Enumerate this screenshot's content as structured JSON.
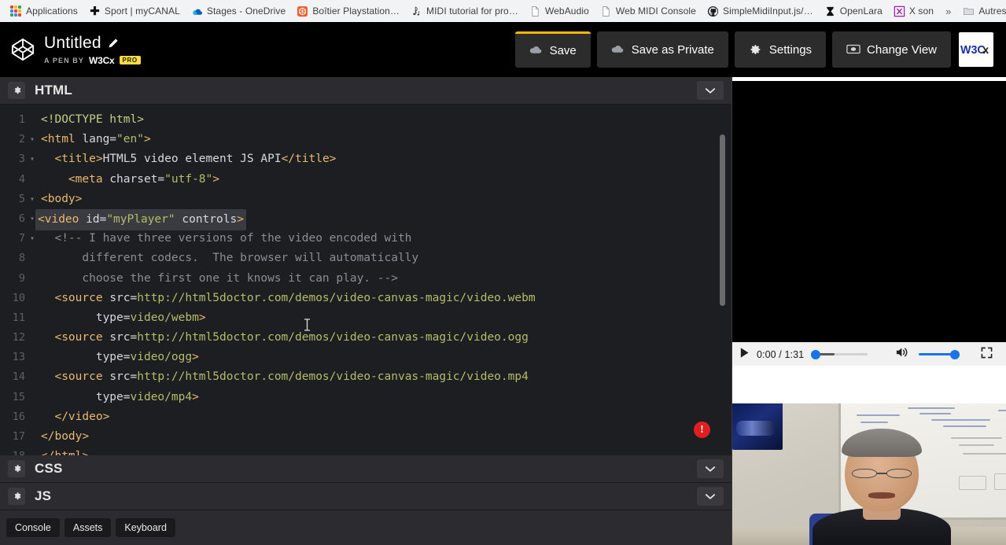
{
  "browser": {
    "bookmarks": [
      {
        "label": "Applications",
        "icon": "apps-grid-icon"
      },
      {
        "label": "Sport | myCANAL",
        "icon": "plus-cross-icon"
      },
      {
        "label": "Stages - OneDrive",
        "icon": "onedrive-cloud-icon"
      },
      {
        "label": "Boîtier Playstation…",
        "icon": "playstation-box-icon"
      },
      {
        "label": "MIDI tutorial for pro…",
        "icon": "music-note-icon"
      },
      {
        "label": "WebAudio",
        "icon": "page-icon"
      },
      {
        "label": "Web MIDI Console",
        "icon": "page-icon"
      },
      {
        "label": "SimpleMidiInput.js/…",
        "icon": "github-icon"
      },
      {
        "label": "OpenLara",
        "icon": "hourglass-icon"
      },
      {
        "label": "X son",
        "icon": "x-purple-icon"
      }
    ],
    "overflow_label": "»",
    "other_bookmarks": {
      "label": "Autres favoris",
      "icon": "folder-icon"
    }
  },
  "header": {
    "logo": "codepen-logo-icon",
    "pen_title": "Untitled",
    "edit_icon": "pencil-icon",
    "byline_prefix": "A PEN BY",
    "byline_user": "W3Cx",
    "pro_badge": "PRO",
    "buttons": [
      {
        "label": "Save",
        "icon": "cloud-icon",
        "accent": "#ffb800"
      },
      {
        "label": "Save as Private",
        "icon": "cloud-icon"
      },
      {
        "label": "Settings",
        "icon": "gear-icon"
      },
      {
        "label": "Change View",
        "icon": "view-rect-icon"
      }
    ],
    "brand_logo": "W3Cx"
  },
  "editor": {
    "panels": [
      {
        "name": "HTML",
        "gear": "gear-icon",
        "collapse": "chevron-down-icon"
      },
      {
        "name": "CSS",
        "gear": "gear-icon",
        "collapse": "chevron-down-icon"
      },
      {
        "name": "JS",
        "gear": "gear-icon",
        "collapse": "chevron-down-icon"
      }
    ],
    "error_badge": "!",
    "lines": [
      {
        "n": "1",
        "fold": "",
        "tokens": [
          {
            "t": "doctype",
            "s": "<!DOCTYPE html>"
          }
        ]
      },
      {
        "n": "2",
        "fold": "▾",
        "tokens": [
          {
            "t": "tag",
            "s": "<html "
          },
          {
            "t": "attr",
            "s": "lang="
          },
          {
            "t": "str",
            "s": "\"en\""
          },
          {
            "t": "tag",
            "s": ">"
          }
        ]
      },
      {
        "n": "3",
        "fold": "▾",
        "tokens": [
          {
            "t": "plain",
            "s": "  "
          },
          {
            "t": "tag",
            "s": "<title>"
          },
          {
            "t": "plain",
            "s": "HTML5 video element JS API"
          },
          {
            "t": "tag",
            "s": "</title>"
          }
        ]
      },
      {
        "n": "4",
        "fold": "",
        "tokens": [
          {
            "t": "plain",
            "s": "    "
          },
          {
            "t": "tag",
            "s": "<meta "
          },
          {
            "t": "attr",
            "s": "charset="
          },
          {
            "t": "str",
            "s": "\"utf-8\""
          },
          {
            "t": "tag",
            "s": ">"
          }
        ]
      },
      {
        "n": "5",
        "fold": "▾",
        "tokens": [
          {
            "t": "tag",
            "s": "<body>"
          }
        ]
      },
      {
        "n": "6",
        "fold": "▾",
        "sel": true,
        "tokens": [
          {
            "t": "tag",
            "s": "<video "
          },
          {
            "t": "attr",
            "s": "id="
          },
          {
            "t": "str",
            "s": "\"myPlayer\""
          },
          {
            "t": "attr",
            "s": " controls"
          },
          {
            "t": "tag",
            "s": ">"
          }
        ]
      },
      {
        "n": "7",
        "fold": "▾",
        "tokens": [
          {
            "t": "cmt",
            "s": "  <!-- I have three versions of the video encoded with"
          }
        ]
      },
      {
        "n": "8",
        "fold": "",
        "tokens": [
          {
            "t": "cmt",
            "s": "      different codecs.  The browser will automatically"
          }
        ]
      },
      {
        "n": "9",
        "fold": "",
        "tokens": [
          {
            "t": "cmt",
            "s": "      choose the first one it knows it can play. -->"
          }
        ]
      },
      {
        "n": "10",
        "fold": "",
        "tokens": [
          {
            "t": "plain",
            "s": "  "
          },
          {
            "t": "tag",
            "s": "<source "
          },
          {
            "t": "attr",
            "s": "src="
          },
          {
            "t": "val",
            "s": "http://html5doctor.com/demos/video-canvas-magic/video.webm"
          }
        ]
      },
      {
        "n": "11",
        "fold": "",
        "tokens": [
          {
            "t": "plain",
            "s": "        "
          },
          {
            "t": "attr",
            "s": "type="
          },
          {
            "t": "val",
            "s": "video/webm"
          },
          {
            "t": "tag",
            "s": ">"
          }
        ]
      },
      {
        "n": "12",
        "fold": "",
        "tokens": [
          {
            "t": "plain",
            "s": "  "
          },
          {
            "t": "tag",
            "s": "<source "
          },
          {
            "t": "attr",
            "s": "src="
          },
          {
            "t": "val",
            "s": "http://html5doctor.com/demos/video-canvas-magic/video.ogg"
          }
        ]
      },
      {
        "n": "13",
        "fold": "",
        "tokens": [
          {
            "t": "plain",
            "s": "        "
          },
          {
            "t": "attr",
            "s": "type="
          },
          {
            "t": "val",
            "s": "video/ogg"
          },
          {
            "t": "tag",
            "s": ">"
          }
        ]
      },
      {
        "n": "14",
        "fold": "",
        "tokens": [
          {
            "t": "plain",
            "s": "  "
          },
          {
            "t": "tag",
            "s": "<source "
          },
          {
            "t": "attr",
            "s": "src="
          },
          {
            "t": "val",
            "s": "http://html5doctor.com/demos/video-canvas-magic/video.mp4"
          }
        ]
      },
      {
        "n": "15",
        "fold": "",
        "tokens": [
          {
            "t": "plain",
            "s": "        "
          },
          {
            "t": "attr",
            "s": "type="
          },
          {
            "t": "val",
            "s": "video/mp4"
          },
          {
            "t": "tag",
            "s": ">"
          }
        ]
      },
      {
        "n": "16",
        "fold": "",
        "tokens": [
          {
            "t": "plain",
            "s": "  "
          },
          {
            "t": "tag",
            "s": "</video>"
          }
        ]
      },
      {
        "n": "17",
        "fold": "",
        "tokens": [
          {
            "t": "tag",
            "s": "</body>"
          }
        ]
      },
      {
        "n": "18",
        "fold": "",
        "tokens": [
          {
            "t": "tag",
            "s": "</html>"
          }
        ]
      }
    ]
  },
  "bottom_tabs": [
    {
      "label": "Console"
    },
    {
      "label": "Assets"
    },
    {
      "label": "Keyboard"
    }
  ],
  "preview": {
    "player": {
      "play_icon": "play-icon",
      "time": "0:00 / 1:31",
      "seek_position_pct": 0,
      "volume_icon": "volume-high-icon",
      "volume_pct": 100,
      "fullscreen_icon": "fullscreen-icon",
      "download_icon": "download-icon",
      "accent": "#1a73e8"
    },
    "webcam": "webcam-overlay"
  }
}
